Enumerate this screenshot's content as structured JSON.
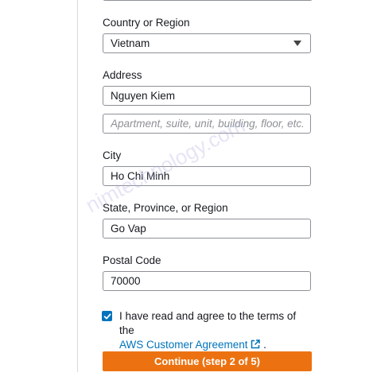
{
  "form": {
    "country_label": "Country or Region",
    "country_value": "Vietnam",
    "address_label": "Address",
    "address_line1": "Nguyen Kiem",
    "address_line2_placeholder": "Apartment, suite, unit, building, floor, etc.",
    "city_label": "City",
    "city_value": "Ho Chi Minh",
    "state_label": "State, Province, or Region",
    "state_value": "Go Vap",
    "postal_label": "Postal Code",
    "postal_value": "70000",
    "agree_text": "I have read and agree to the terms of the",
    "agreement_link": "AWS Customer Agreement",
    "agree_period": ".",
    "agree_checked": true,
    "continue_label": "Continue (step 2 of 5)"
  },
  "watermark": "nimtechnology.com",
  "colors": {
    "accent": "#ec7211",
    "link": "#0073bb",
    "border": "#8d9096"
  },
  "icons": {
    "dropdown": "triangle-down-icon",
    "external": "external-link-icon",
    "check": "check-icon"
  }
}
